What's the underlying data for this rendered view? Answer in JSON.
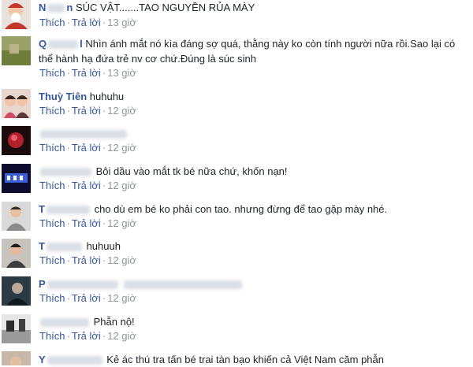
{
  "comments": [
    {
      "name": "N",
      "name_tail": "n",
      "text": "SÚC VẬT.......TAO NGUYỀN RỦA MÀY",
      "like": "Thích",
      "reply": "Trả lời",
      "time": "13 giờ"
    },
    {
      "name": "Q",
      "name_tail": "l",
      "text": "Nhìn ánh mắt nó kìa đáng sợ quá, thằng này ko còn tính người nữa rồi.Sao lại có thể hành hạ đứa trẻ nv cơ chứ.Đúng là súc sinh",
      "like": "Thích",
      "reply": "Trả lời",
      "time": "13 giờ"
    },
    {
      "name": "Thuỳ Tiên",
      "text": "huhuhu",
      "like": "Thích",
      "reply": "Trả lời",
      "time": "12 giờ"
    },
    {
      "name": "",
      "text": "",
      "like": "Thích",
      "reply": "Trả lời",
      "time": "12 giờ"
    },
    {
      "name": "",
      "text": "Bôi dầu vào mắt tk bé nữa chứ, khốn nạn!",
      "like": "Thích",
      "reply": "Trả lời",
      "time": "12 giờ"
    },
    {
      "name": "T",
      "text": "cho dù em bé ko phải con tao. nhưng đừng để tao gặp mày nhé.",
      "like": "Thích",
      "reply": "Trả lời",
      "time": "12 giờ"
    },
    {
      "name": "T",
      "text": "huhuuh",
      "like": "Thích",
      "reply": "Trả lời",
      "time": "12 giờ"
    },
    {
      "name": "P",
      "text": "",
      "like": "Thích",
      "reply": "Trả lời",
      "time": "12 giờ"
    },
    {
      "name": "",
      "text": "Phẫn nộ!",
      "like": "Thích",
      "reply": "Trả lời",
      "time": "12 giờ"
    },
    {
      "name": "Y",
      "text": "Kẻ ác thú tra tấn bé trai tàn bạo khiến cả Việt Nam căm phẫn",
      "like": "",
      "reply": "",
      "time": ""
    }
  ]
}
